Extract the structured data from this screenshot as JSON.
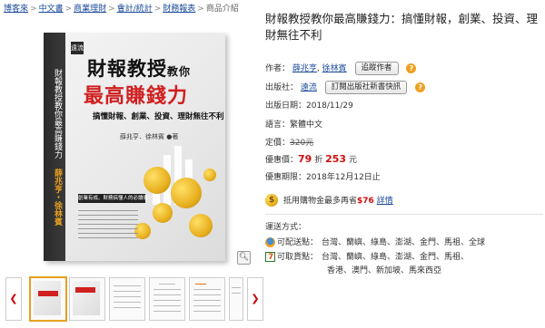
{
  "breadcrumb": {
    "items": [
      "博客來",
      "中文書",
      "商業理財",
      "會計/統計",
      "財務報表"
    ],
    "current": "商品介紹",
    "separator": ">"
  },
  "cover": {
    "publisher_logo": "遠流",
    "title_line1": "財報教授",
    "title_line1_small": "教你",
    "title_line2": "最高賺錢力",
    "subtitle": "搞懂財報、創業、投資、理財無往不利",
    "authors": "薛兆亨．徐林賓 ●著",
    "badge": "創業有成、財務搞懂人的必讀書！",
    "spine_title": "財報教授教你最高賺錢力",
    "spine_authors": "薛兆亨・徐林賓"
  },
  "zoom_icon": "magnifier-icon",
  "thumbnails": {
    "prev_icon": "chevron-left-icon",
    "next_icon": "chevron-right-icon",
    "count": 6,
    "selected_index": 0
  },
  "product": {
    "title": "財報教授教你最高賺錢力：搞懂財報，創業、投資、理財無往不利",
    "author_label": "作者：",
    "authors": [
      "薛兆亨",
      "徐林賓"
    ],
    "follow_author_button": "追蹤作者",
    "publisher_label": "出版社：",
    "publisher": "遠流",
    "subscribe_button": "訂閱出版社新書快訊",
    "pub_date": "出版日期：2018/11/29",
    "language": "語言：繁體中文",
    "list_price_label": "定價：",
    "list_price": "320元",
    "sale_label": "優惠價：",
    "discount": "79",
    "discount_unit": "折",
    "sale_price": "253",
    "sale_unit": "元",
    "sale_period": "優惠期限：2018年12月12日止",
    "bonus_text_pre": "抵用購物金最多再省",
    "bonus_amount": "$76",
    "bonus_link": "詳情",
    "shipping_label": "運送方式：",
    "delivery_label": "可配送點：",
    "delivery_regions": "台灣、蘭嶼、綠島、澎湖、金門、馬祖、全球",
    "pickup_label": "可取貨點：",
    "pickup_regions_1": "台灣、蘭嶼、綠島、澎湖、金門、馬祖、",
    "pickup_regions_2": "香港、澳門、新加坡、馬來西亞"
  },
  "colors": {
    "link": "#1a4a9a",
    "price_red": "#d01010",
    "accent_orange": "#f0a020",
    "cover_red": "#d02020"
  }
}
